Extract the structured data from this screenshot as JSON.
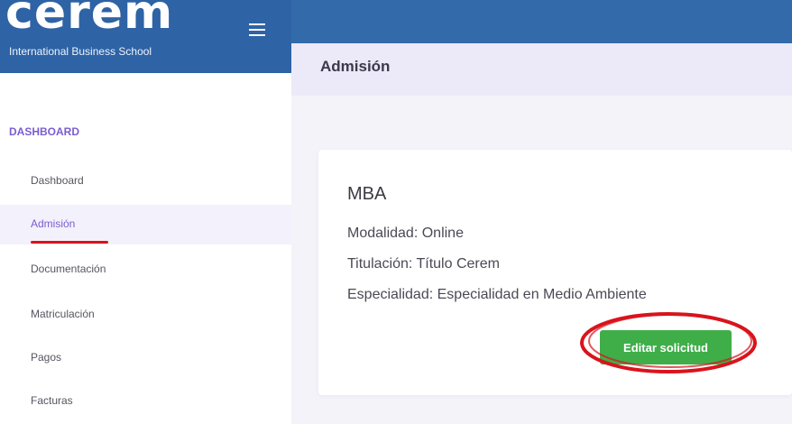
{
  "brand": {
    "logo": "cerem",
    "tagline": "International Business School"
  },
  "header": {
    "menu_icon": "hamburger-icon",
    "page_title": "Admisión"
  },
  "sidebar": {
    "section_title": "DASHBOARD",
    "items": [
      {
        "label": "Dashboard",
        "active": false
      },
      {
        "label": "Admisión",
        "active": true
      },
      {
        "label": "Documentación",
        "active": false
      },
      {
        "label": "Matriculación",
        "active": false
      },
      {
        "label": "Pagos",
        "active": false
      },
      {
        "label": "Facturas",
        "active": false
      }
    ]
  },
  "card": {
    "title": "MBA",
    "modalidad": "Modalidad: Online",
    "titulacion": "Titulación: Título Cerem",
    "especialidad": "Especialidad: Especialidad en Medio Ambiente",
    "button_label": "Editar solicitud"
  },
  "colors": {
    "topbar": "#336aaa",
    "accent_purple": "#7a5dd1",
    "button_green": "#3fae49",
    "annotation_red": "#d8141c"
  }
}
